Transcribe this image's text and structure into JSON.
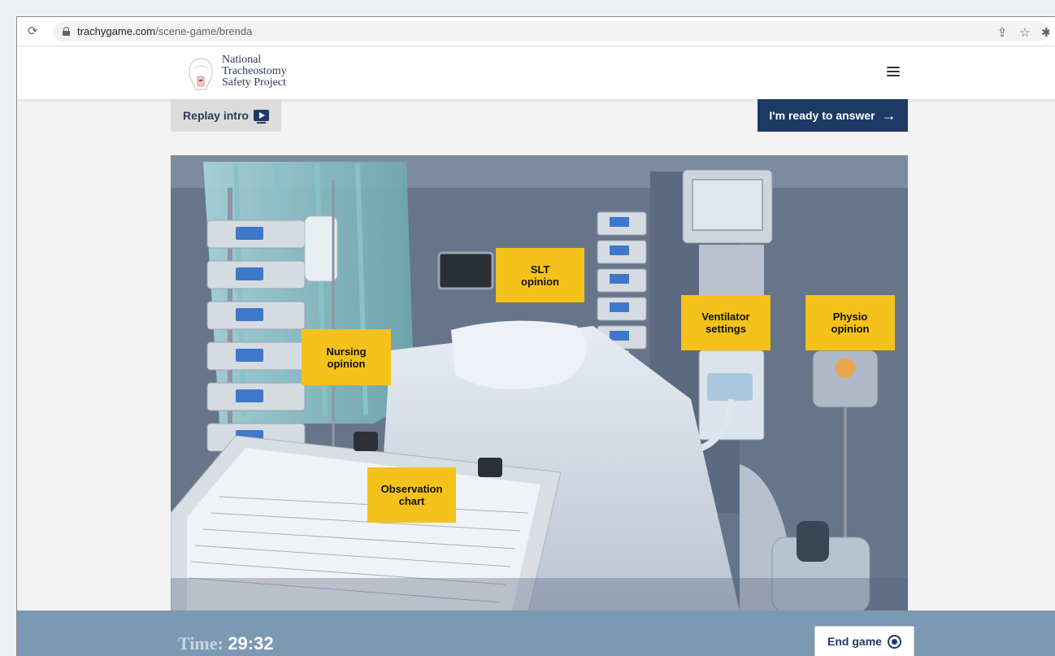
{
  "browser": {
    "url_domain": "trachygame.com",
    "url_path": "/scene-game/brenda",
    "icons": [
      "reload-icon",
      "lock-icon",
      "share-icon",
      "star-icon",
      "pin-icon"
    ]
  },
  "header": {
    "logo_lines": [
      "National",
      "Tracheostomy",
      "Safety Project"
    ],
    "menu_icon": "hamburger-menu-icon"
  },
  "toolbar": {
    "replay_label": "Replay intro",
    "replay_icon": "tv-play-icon",
    "ready_label": "I'm ready to answer",
    "ready_icon": "arrow-right-icon"
  },
  "scene": {
    "description_icon": "hospital-bed-scene",
    "hotspots": [
      {
        "id": "slt",
        "line1": "SLT",
        "line2": "opinion"
      },
      {
        "id": "ventilator",
        "line1": "Ventilator",
        "line2": "settings"
      },
      {
        "id": "physio",
        "line1": "Physio",
        "line2": "opinion"
      },
      {
        "id": "nursing",
        "line1": "Nursing",
        "line2": "opinion"
      },
      {
        "id": "observation",
        "line1": "Observation",
        "line2": "chart"
      }
    ]
  },
  "footer": {
    "time_label": "Time:",
    "time_value": "29:32",
    "end_label": "End game",
    "end_icon": "stop-circle-icon"
  },
  "colors": {
    "navy": "#1d3a66",
    "hotspot_yellow": "#f4c21b",
    "footer_blue": "#7c99b4"
  }
}
